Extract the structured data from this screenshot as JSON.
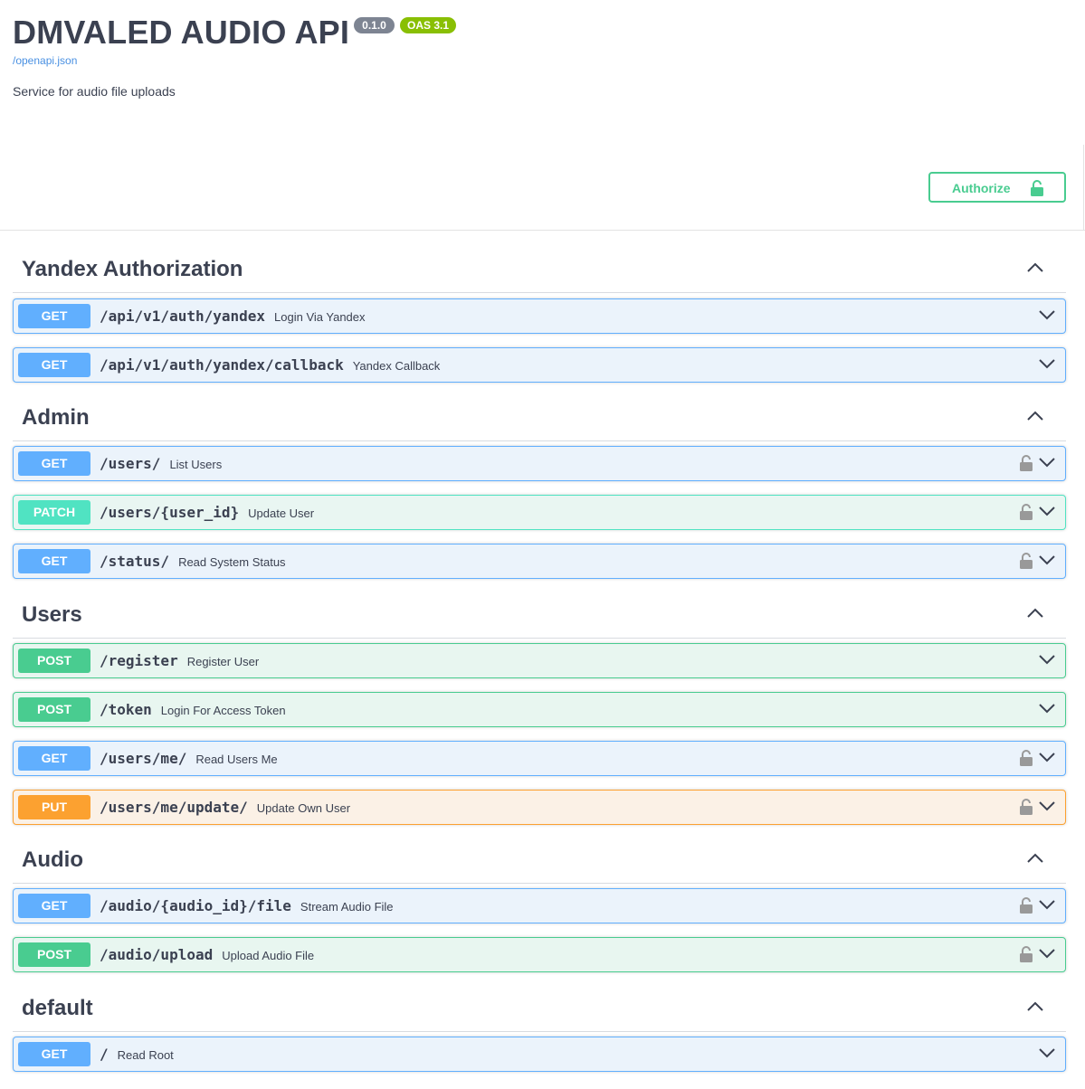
{
  "info": {
    "title": "DMVALED AUDIO API",
    "version": "0.1.0",
    "oas": "OAS 3.1",
    "openapi_link": "/openapi.json",
    "description": "Service for audio file uploads"
  },
  "authorize": {
    "label": "Authorize",
    "icon": "unlock-icon"
  },
  "colors": {
    "get": "#61affe",
    "post": "#49cc90",
    "patch": "#50e3c2",
    "put": "#fca130",
    "authorize": "#49cc90"
  },
  "tags": [
    {
      "name": "Yandex Authorization",
      "operations": [
        {
          "method": "GET",
          "path": "/api/v1/auth/yandex",
          "summary": "Login Via Yandex",
          "locked": false
        },
        {
          "method": "GET",
          "path": "/api/v1/auth/yandex/callback",
          "summary": "Yandex Callback",
          "locked": false
        }
      ]
    },
    {
      "name": "Admin",
      "operations": [
        {
          "method": "GET",
          "path": "/users/",
          "summary": "List Users",
          "locked": true
        },
        {
          "method": "PATCH",
          "path": "/users/{user_id}",
          "summary": "Update User",
          "locked": true
        },
        {
          "method": "GET",
          "path": "/status/",
          "summary": "Read System Status",
          "locked": true
        }
      ]
    },
    {
      "name": "Users",
      "operations": [
        {
          "method": "POST",
          "path": "/register",
          "summary": "Register User",
          "locked": false
        },
        {
          "method": "POST",
          "path": "/token",
          "summary": "Login For Access Token",
          "locked": false
        },
        {
          "method": "GET",
          "path": "/users/me/",
          "summary": "Read Users Me",
          "locked": true
        },
        {
          "method": "PUT",
          "path": "/users/me/update/",
          "summary": "Update Own User",
          "locked": true
        }
      ]
    },
    {
      "name": "Audio",
      "operations": [
        {
          "method": "GET",
          "path": "/audio/{audio_id}/file",
          "summary": "Stream Audio File",
          "locked": true
        },
        {
          "method": "POST",
          "path": "/audio/upload",
          "summary": "Upload Audio File",
          "locked": true
        }
      ]
    },
    {
      "name": "default",
      "operations": [
        {
          "method": "GET",
          "path": "/",
          "summary": "Read Root",
          "locked": false
        }
      ]
    }
  ]
}
